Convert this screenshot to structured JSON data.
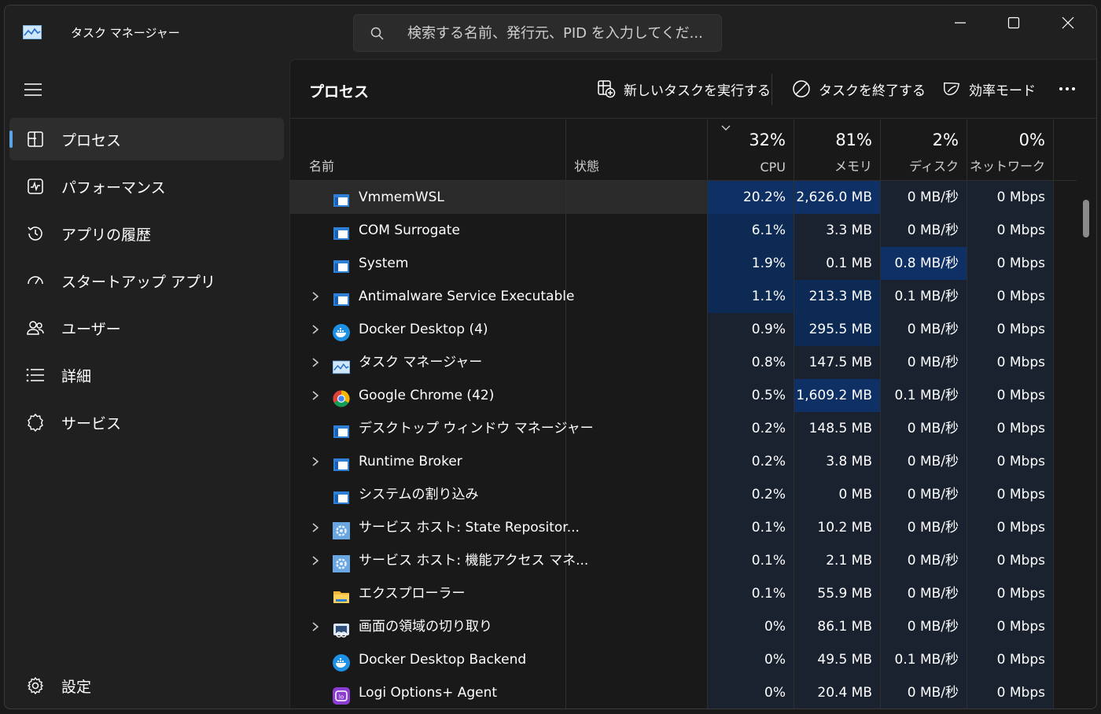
{
  "window": {
    "title": "タスク マネージャー"
  },
  "search": {
    "placeholder": "検索する名前、発行元、PID を入力してくだ..."
  },
  "sidebar": {
    "items": [
      {
        "label": "プロセス",
        "icon": "processes-icon",
        "active": true
      },
      {
        "label": "パフォーマンス",
        "icon": "performance-icon"
      },
      {
        "label": "アプリの履歴",
        "icon": "history-icon"
      },
      {
        "label": "スタートアップ アプリ",
        "icon": "startup-icon"
      },
      {
        "label": "ユーザー",
        "icon": "users-icon"
      },
      {
        "label": "詳細",
        "icon": "details-icon"
      },
      {
        "label": "サービス",
        "icon": "services-icon"
      }
    ],
    "settings_label": "設定"
  },
  "toolbar": {
    "page_title": "プロセス",
    "new_task_label": "新しいタスクを実行する",
    "end_task_label": "タスクを終了する",
    "efficiency_label": "効率モード"
  },
  "columns": {
    "name": "名前",
    "status": "状態",
    "cpu": {
      "pct": "32%",
      "label": "CPU"
    },
    "memory": {
      "pct": "81%",
      "label": "メモリ"
    },
    "disk": {
      "pct": "2%",
      "label": "ディスク"
    },
    "network": {
      "pct": "0%",
      "label": "ネットワーク"
    }
  },
  "colors": {
    "heat_1": "#0f3064",
    "heat_2": "#0d2a55",
    "heat_3": "#0c2448",
    "heat_4": "#1a2230",
    "accent": "#5ba3e8"
  },
  "processes": [
    {
      "name": "VmmemWSL",
      "icon": "window-app-icon",
      "expandable": false,
      "cpu": "20.2%",
      "mem": "2,626.0 MB",
      "disk": "0 MB/秒",
      "net": "0 Mbps",
      "heat": [
        1,
        1,
        4,
        4
      ]
    },
    {
      "name": "COM Surrogate",
      "icon": "window-app-icon",
      "expandable": false,
      "cpu": "6.1%",
      "mem": "3.3 MB",
      "disk": "0 MB/秒",
      "net": "0 Mbps",
      "heat": [
        2,
        4,
        4,
        4
      ]
    },
    {
      "name": "System",
      "icon": "window-app-icon",
      "expandable": false,
      "cpu": "1.9%",
      "mem": "0.1 MB",
      "disk": "0.8 MB/秒",
      "net": "0 Mbps",
      "heat": [
        2,
        4,
        1,
        4
      ]
    },
    {
      "name": "Antimalware Service Executable",
      "icon": "window-app-icon",
      "expandable": true,
      "cpu": "1.1%",
      "mem": "213.3 MB",
      "disk": "0.1 MB/秒",
      "net": "0 Mbps",
      "heat": [
        2,
        2,
        4,
        4
      ]
    },
    {
      "name": "Docker Desktop (4)",
      "icon": "docker-icon",
      "expandable": true,
      "cpu": "0.9%",
      "mem": "295.5 MB",
      "disk": "0 MB/秒",
      "net": "0 Mbps",
      "heat": [
        4,
        2,
        4,
        4
      ]
    },
    {
      "name": "タスク マネージャー",
      "icon": "task-manager-icon",
      "expandable": true,
      "cpu": "0.8%",
      "mem": "147.5 MB",
      "disk": "0 MB/秒",
      "net": "0 Mbps",
      "heat": [
        4,
        4,
        4,
        4
      ]
    },
    {
      "name": "Google Chrome (42)",
      "icon": "chrome-icon",
      "expandable": true,
      "cpu": "0.5%",
      "mem": "1,609.2 MB",
      "disk": "0.1 MB/秒",
      "net": "0 Mbps",
      "heat": [
        4,
        1,
        4,
        4
      ]
    },
    {
      "name": "デスクトップ ウィンドウ マネージャー",
      "icon": "window-app-icon",
      "expandable": false,
      "cpu": "0.2%",
      "mem": "148.5 MB",
      "disk": "0 MB/秒",
      "net": "0 Mbps",
      "heat": [
        4,
        4,
        4,
        4
      ]
    },
    {
      "name": "Runtime Broker",
      "icon": "window-app-icon",
      "expandable": true,
      "cpu": "0.2%",
      "mem": "3.8 MB",
      "disk": "0 MB/秒",
      "net": "0 Mbps",
      "heat": [
        4,
        4,
        4,
        4
      ]
    },
    {
      "name": "システムの割り込み",
      "icon": "window-app-icon",
      "expandable": false,
      "cpu": "0.2%",
      "mem": "0 MB",
      "disk": "0 MB/秒",
      "net": "0 Mbps",
      "heat": [
        4,
        4,
        4,
        4
      ]
    },
    {
      "name": "サービス ホスト: State Repositor...",
      "icon": "gear-app-icon",
      "expandable": true,
      "cpu": "0.1%",
      "mem": "10.2 MB",
      "disk": "0 MB/秒",
      "net": "0 Mbps",
      "heat": [
        4,
        4,
        4,
        4
      ]
    },
    {
      "name": "サービス ホスト: 機能アクセス マネ...",
      "icon": "gear-app-icon",
      "expandable": true,
      "cpu": "0.1%",
      "mem": "2.1 MB",
      "disk": "0 MB/秒",
      "net": "0 Mbps",
      "heat": [
        4,
        4,
        4,
        4
      ]
    },
    {
      "name": "エクスプローラー",
      "icon": "folder-icon",
      "expandable": false,
      "cpu": "0.1%",
      "mem": "55.9 MB",
      "disk": "0 MB/秒",
      "net": "0 Mbps",
      "heat": [
        4,
        4,
        4,
        4
      ]
    },
    {
      "name": "画面の領域の切り取り",
      "icon": "snipping-tool-icon",
      "expandable": true,
      "cpu": "0%",
      "mem": "86.1 MB",
      "disk": "0 MB/秒",
      "net": "0 Mbps",
      "heat": [
        4,
        4,
        4,
        4
      ]
    },
    {
      "name": "Docker Desktop Backend",
      "icon": "docker-icon",
      "expandable": false,
      "cpu": "0%",
      "mem": "49.5 MB",
      "disk": "0.1 MB/秒",
      "net": "0 Mbps",
      "heat": [
        4,
        4,
        4,
        4
      ]
    },
    {
      "name": "Logi Options+ Agent",
      "icon": "logi-icon",
      "expandable": false,
      "cpu": "0%",
      "mem": "20.4 MB",
      "disk": "0 MB/秒",
      "net": "0 Mbps",
      "heat": [
        4,
        4,
        4,
        4
      ]
    }
  ]
}
